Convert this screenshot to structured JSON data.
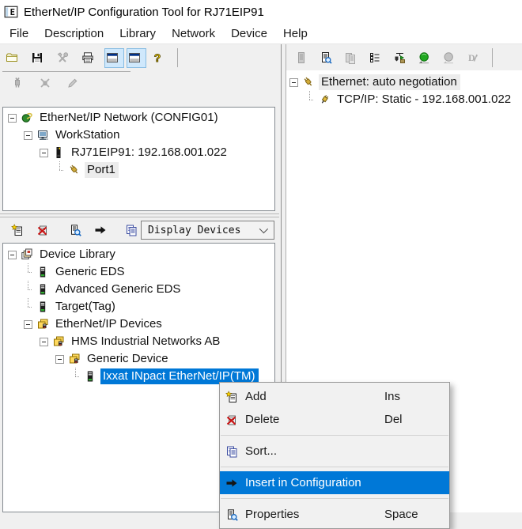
{
  "window": {
    "title": "EtherNet/IP Configuration Tool for RJ71EIP91",
    "app_icon": "app-icon"
  },
  "menu_bar": {
    "items": [
      "File",
      "Description",
      "Library",
      "Network",
      "Device",
      "Help"
    ]
  },
  "main_toolbar": {
    "buttons": [
      {
        "name": "open-button",
        "icon": "folder-icon",
        "state": "normal"
      },
      {
        "name": "save-button",
        "icon": "save-icon",
        "state": "normal"
      },
      {
        "name": "tools-button",
        "icon": "tools-icon",
        "state": "disabled"
      },
      {
        "name": "print-button",
        "icon": "print-icon",
        "state": "normal"
      },
      {
        "name": "view-left-pane-button",
        "icon": "pane-icon",
        "state": "checked"
      },
      {
        "name": "view-right-pane-button",
        "icon": "pane-icon",
        "state": "checked"
      },
      {
        "name": "help-button",
        "icon": "help-icon",
        "state": "normal"
      },
      {
        "type": "separator"
      }
    ]
  },
  "network_toolbar": {
    "buttons": [
      {
        "name": "connect-button",
        "icon": "plug-icon",
        "state": "disabled"
      },
      {
        "name": "disconnect-button",
        "icon": "plug-x-icon",
        "state": "disabled"
      },
      {
        "name": "edit-connection-button",
        "icon": "pencil-gray-icon",
        "state": "disabled"
      }
    ]
  },
  "interface_toolbar": {
    "buttons": [
      {
        "name": "download-module-button",
        "icon": "module-gray-icon",
        "state": "disabled"
      },
      {
        "name": "verify-module-button",
        "icon": "module-search-icon",
        "state": "normal"
      },
      {
        "name": "compare-modules-button",
        "icon": "modules-gray-icon",
        "state": "disabled"
      },
      {
        "name": "task-list-button",
        "icon": "list-icon",
        "state": "normal"
      },
      {
        "name": "insert-network-button",
        "icon": "network-add-icon",
        "state": "normal"
      },
      {
        "name": "go-online-button",
        "icon": "globe-green-icon",
        "state": "normal"
      },
      {
        "name": "go-offline-button",
        "icon": "globe-gray-icon",
        "state": "disabled"
      },
      {
        "name": "diagnostics-button",
        "icon": "d-slash-icon",
        "state": "disabled"
      },
      {
        "type": "separator"
      }
    ]
  },
  "library_toolbar": {
    "buttons": [
      {
        "name": "add-device-button",
        "icon": "add-device-icon",
        "state": "normal"
      },
      {
        "name": "delete-device-button",
        "icon": "delete-device-icon",
        "state": "normal"
      },
      {
        "type": "spacer1"
      },
      {
        "name": "device-properties-button",
        "icon": "properties-device-icon",
        "state": "normal"
      },
      {
        "name": "insert-in-configuration-button",
        "icon": "insert-arrow-icon",
        "state": "normal"
      },
      {
        "type": "spacer2"
      },
      {
        "name": "sort-devices-button",
        "icon": "sort-icon",
        "state": "normal"
      }
    ],
    "filter_value": "Display Devices"
  },
  "network_tree": {
    "items": [
      {
        "depth": 0,
        "expand": true,
        "icon": "network-icon",
        "label": "EtherNet/IP Network (CONFIG01)"
      },
      {
        "depth": 1,
        "expand": true,
        "icon": "workstation-icon",
        "label": "WorkStation"
      },
      {
        "depth": 2,
        "expand": true,
        "icon": "module-black-icon",
        "label": "RJ71EIP91: 192.168.001.022"
      },
      {
        "depth": 3,
        "expand": false,
        "icon": "port-icon",
        "label": "Port1",
        "state": "inactive"
      }
    ]
  },
  "interface_tree": {
    "items": [
      {
        "depth": 0,
        "expand": true,
        "icon": "ethernet-icon",
        "label": "Ethernet: auto negotiation",
        "state": "inactive"
      },
      {
        "depth": 1,
        "expand": false,
        "icon": "tcpip-icon",
        "label": "TCP/IP: Static - 192.168.001.022"
      }
    ]
  },
  "library_tree": {
    "items": [
      {
        "depth": 0,
        "expand": true,
        "icon": "library-icon",
        "label": "Device Library"
      },
      {
        "depth": 1,
        "expand": false,
        "icon": "device-icon",
        "label": "Generic EDS"
      },
      {
        "depth": 1,
        "expand": false,
        "icon": "device-icon",
        "label": "Advanced Generic EDS"
      },
      {
        "depth": 1,
        "expand": false,
        "icon": "device-icon",
        "label": "Target(Tag)"
      },
      {
        "depth": 1,
        "expand": true,
        "icon": "device-group-icon",
        "label": "EtherNet/IP Devices"
      },
      {
        "depth": 2,
        "expand": true,
        "icon": "device-group-icon",
        "label": "HMS Industrial Networks AB"
      },
      {
        "depth": 3,
        "expand": true,
        "icon": "device-group-icon",
        "label": "Generic Device"
      },
      {
        "depth": 4,
        "expand": false,
        "icon": "device-icon",
        "label": "Ixxat INpact EtherNet/IP(TM)",
        "state": "selected"
      }
    ]
  },
  "context_menu": {
    "items": [
      {
        "icon": "add-device-icon",
        "label": "Add",
        "shortcut": "Ins"
      },
      {
        "icon": "delete-device-icon",
        "label": "Delete",
        "shortcut": "Del"
      },
      {
        "type": "separator"
      },
      {
        "icon": "sort-icon",
        "label": "Sort..."
      },
      {
        "type": "separator"
      },
      {
        "icon": "insert-arrow-icon",
        "label": "Insert in Configuration",
        "highlighted": true
      },
      {
        "type": "separator"
      },
      {
        "icon": "properties-device-icon",
        "label": "Properties",
        "shortcut": "Space"
      }
    ]
  },
  "colors": {
    "selection_blue": "#0078d7",
    "toolbar_checked_bg": "#cfe8fc",
    "toolbar_checked_border": "#86bbe2",
    "panel_border": "#848a90",
    "window_bg": "#f0f0f0",
    "disabled_gray": "#ababab"
  }
}
